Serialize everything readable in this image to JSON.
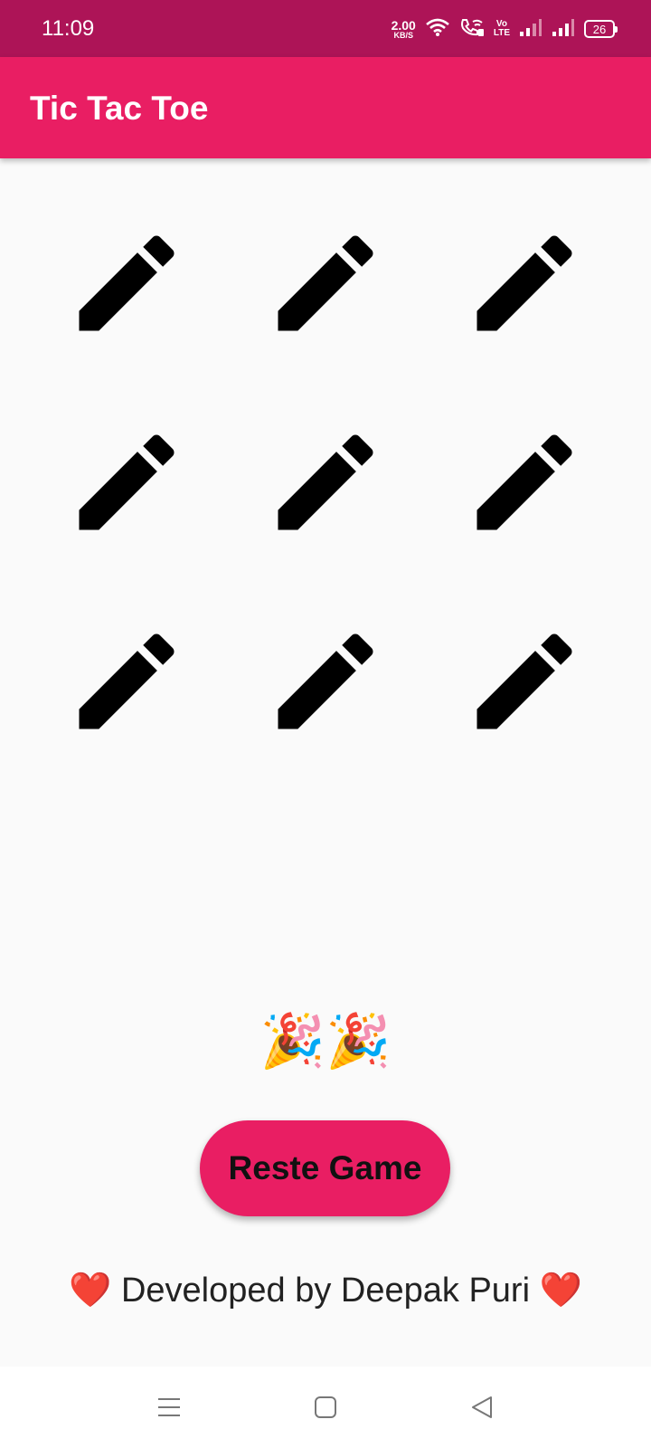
{
  "status_bar": {
    "time": "11:09",
    "net_speed_value": "2.00",
    "net_speed_unit": "KB/S",
    "volte_top": "Vo",
    "volte_bottom": "LTE",
    "battery_level": "26",
    "icons": [
      "wifi-icon",
      "wifi-calling-icon",
      "volte-icon",
      "signal-sim1-icon",
      "signal-sim2-icon",
      "battery-icon"
    ]
  },
  "app_bar": {
    "title": "Tic Tac Toe"
  },
  "board": {
    "cells": [
      {
        "icon": "pencil-icon",
        "value": ""
      },
      {
        "icon": "pencil-icon",
        "value": ""
      },
      {
        "icon": "pencil-icon",
        "value": ""
      },
      {
        "icon": "pencil-icon",
        "value": ""
      },
      {
        "icon": "pencil-icon",
        "value": ""
      },
      {
        "icon": "pencil-icon",
        "value": ""
      },
      {
        "icon": "pencil-icon",
        "value": ""
      },
      {
        "icon": "pencil-icon",
        "value": ""
      },
      {
        "icon": "pencil-icon",
        "value": ""
      }
    ]
  },
  "result": {
    "message": "🎉🎉"
  },
  "reset_button": {
    "label": "Reste Game"
  },
  "footer": {
    "credit": "❤️ Developed by Deepak Puri ❤️"
  },
  "nav_bar": {
    "icons": [
      "menu-icon",
      "home-icon",
      "back-icon"
    ]
  },
  "colors": {
    "status_bar": "#ad1457",
    "app_bar": "#e91e63",
    "background": "#fafafa",
    "button": "#e91e63"
  }
}
